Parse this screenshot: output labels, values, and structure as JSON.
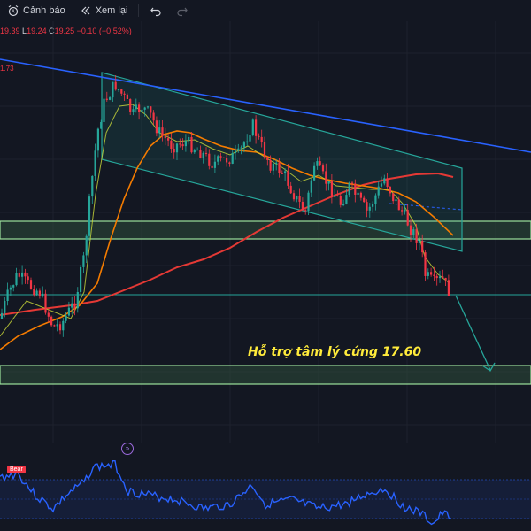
{
  "toolbar": {
    "alert_label": "Cảnh báo",
    "replay_label": "Xem lại"
  },
  "legend": {
    "h": "19.39",
    "l_prefix": "L",
    "l": "19.24",
    "c_prefix": "C",
    "c": "19.25",
    "change": "−0.10 (−0.52%)"
  },
  "price_label": "1.73",
  "annotation": "Hỗ trợ tâm lý cứng 17.60",
  "oscillator": {
    "badge": "Bear"
  },
  "colors": {
    "background": "#131722",
    "up_candle": "#26a69a",
    "down_candle": "#f23645",
    "trendline": "#2962ff",
    "channel": "#26a69a",
    "ma_orange": "#f57c00",
    "ma_red": "#e53935",
    "annotation": "#ffeb3b",
    "oscillator": "#2962ff"
  },
  "icons": [
    "alarm-clock-icon",
    "rewind-icon",
    "undo-icon",
    "redo-icon",
    "replay-icon"
  ]
}
